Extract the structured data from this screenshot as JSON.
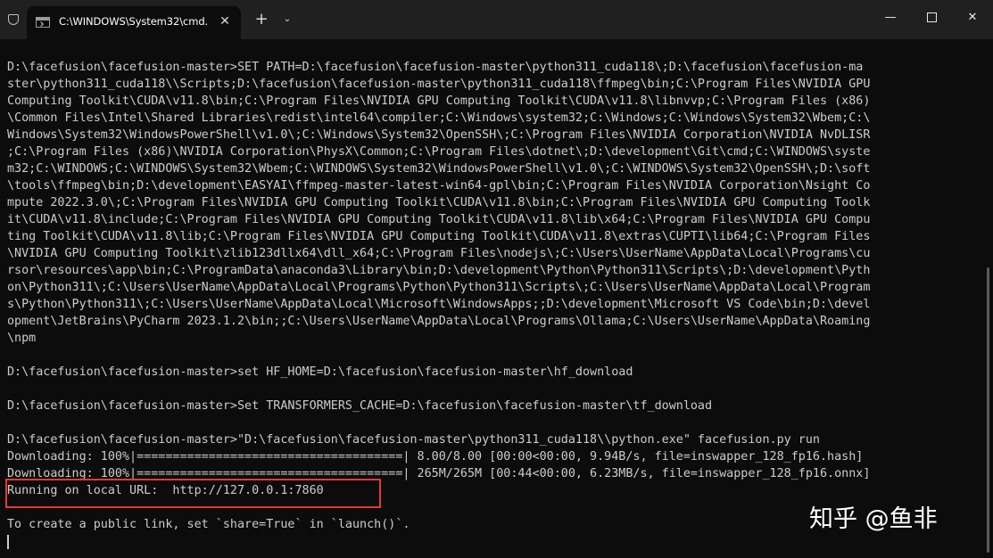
{
  "window": {
    "tab_title": "C:\\WINDOWS\\System32\\cmd.",
    "tab_close": "✕",
    "new_tab": "+",
    "dropdown": "⌄",
    "minimize": "—",
    "close": "✕"
  },
  "icons": {
    "shield": "shield-icon",
    "terminal": "cmd-icon"
  },
  "terminal": {
    "lines": [
      "D:\\facefusion\\facefusion-master>SET PATH=D:\\facefusion\\facefusion-master\\python311_cuda118\\;D:\\facefusion\\facefusion-ma",
      "ster\\python311_cuda118\\\\Scripts;D:\\facefusion\\facefusion-master\\python311_cuda118\\ffmpeg\\bin;C:\\Program Files\\NVIDIA GPU",
      "Computing Toolkit\\CUDA\\v11.8\\bin;C:\\Program Files\\NVIDIA GPU Computing Toolkit\\CUDA\\v11.8\\libnvvp;C:\\Program Files (x86)",
      "\\Common Files\\Intel\\Shared Libraries\\redist\\intel64\\compiler;C:\\Windows\\system32;C:\\Windows;C:\\Windows\\System32\\Wbem;C:\\",
      "Windows\\System32\\WindowsPowerShell\\v1.0\\;C:\\Windows\\System32\\OpenSSH\\;C:\\Program Files\\NVIDIA Corporation\\NVIDIA NvDLISR",
      ";C:\\Program Files (x86)\\NVIDIA Corporation\\PhysX\\Common;C:\\Program Files\\dotnet\\;D:\\development\\Git\\cmd;C:\\WINDOWS\\syste",
      "m32;C:\\WINDOWS;C:\\WINDOWS\\System32\\Wbem;C:\\WINDOWS\\System32\\WindowsPowerShell\\v1.0\\;C:\\WINDOWS\\System32\\OpenSSH\\;D:\\soft",
      "\\tools\\ffmpeg\\bin;D:\\development\\EASYAI\\ffmpeg-master-latest-win64-gpl\\bin;C:\\Program Files\\NVIDIA Corporation\\Nsight Co",
      "mpute 2022.3.0\\;C:\\Program Files\\NVIDIA GPU Computing Toolkit\\CUDA\\v11.8\\bin;C:\\Program Files\\NVIDIA GPU Computing Toolk",
      "it\\CUDA\\v11.8\\include;C:\\Program Files\\NVIDIA GPU Computing Toolkit\\CUDA\\v11.8\\lib\\x64;C:\\Program Files\\NVIDIA GPU Compu",
      "ting Toolkit\\CUDA\\v11.8\\lib;C:\\Program Files\\NVIDIA GPU Computing Toolkit\\CUDA\\v11.8\\extras\\CUPTI\\lib64;C:\\Program Files",
      "\\NVIDIA GPU Computing Toolkit\\zlib123dllx64\\dll_x64;C:\\Program Files\\nodejs\\;C:\\Users\\UserName\\AppData\\Local\\Programs\\cu",
      "rsor\\resources\\app\\bin;C:\\ProgramData\\anaconda3\\Library\\bin;D:\\development\\Python\\Python311\\Scripts\\;D:\\development\\Pyth",
      "on\\Python311\\;C:\\Users\\UserName\\AppData\\Local\\Programs\\Python\\Python311\\Scripts\\;C:\\Users\\UserName\\AppData\\Local\\Program",
      "s\\Python\\Python311\\;C:\\Users\\UserName\\AppData\\Local\\Microsoft\\WindowsApps;;D:\\development\\Microsoft VS Code\\bin;D:\\devel",
      "opment\\JetBrains\\PyCharm 2023.1.2\\bin;;C:\\Users\\UserName\\AppData\\Local\\Programs\\Ollama;C:\\Users\\UserName\\AppData\\Roaming",
      "\\npm",
      "",
      "D:\\facefusion\\facefusion-master>set HF_HOME=D:\\facefusion\\facefusion-master\\hf_download",
      "",
      "D:\\facefusion\\facefusion-master>Set TRANSFORMERS_CACHE=D:\\facefusion\\facefusion-master\\tf_download",
      "",
      "D:\\facefusion\\facefusion-master>\"D:\\facefusion\\facefusion-master\\python311_cuda118\\\\python.exe\" facefusion.py run",
      "Downloading: 100%|=====================================| 8.00/8.00 [00:00<00:00, 9.94B/s, file=inswapper_128_fp16.hash]",
      "Downloading: 100%|=====================================| 265M/265M [00:44<00:00, 6.23MB/s, file=inswapper_128_fp16.onnx]",
      "Running on local URL:  http://127.0.0.1:7860",
      "",
      "To create a public link, set `share=True` in `launch()`."
    ]
  },
  "watermark": "知乎 @鱼非"
}
